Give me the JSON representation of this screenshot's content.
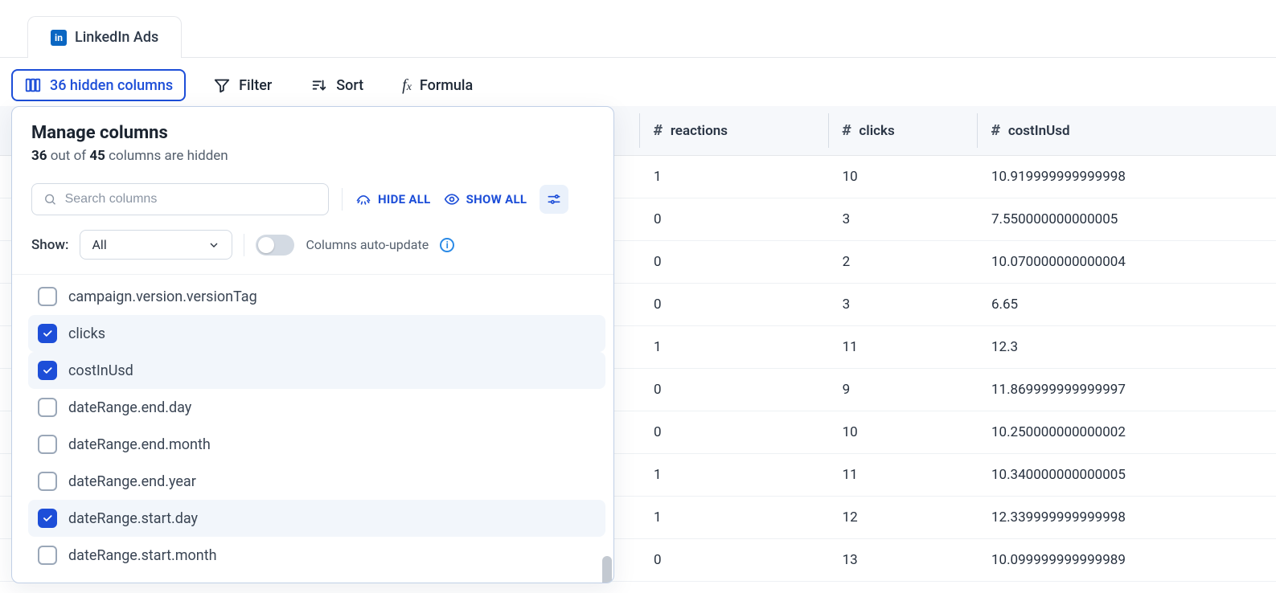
{
  "tab": {
    "label": "LinkedIn Ads",
    "icon_letters": "in"
  },
  "toolbar": {
    "hidden_columns": "36 hidden columns",
    "filter": "Filter",
    "sort": "Sort",
    "formula": "Formula"
  },
  "popover": {
    "title": "Manage columns",
    "subtitle_prefix_bold": "36",
    "subtitle_mid": " out of ",
    "subtitle_mid_bold": "45",
    "subtitle_suffix": " columns are hidden",
    "search_placeholder": "Search columns",
    "hide_all": "HIDE ALL",
    "show_all": "SHOW ALL",
    "show_label": "Show:",
    "show_value": "All",
    "auto_update": "Columns auto-update",
    "items": [
      {
        "label": "campaign.version.versionTag",
        "checked": false
      },
      {
        "label": "clicks",
        "checked": true
      },
      {
        "label": "costInUsd",
        "checked": true
      },
      {
        "label": "dateRange.end.day",
        "checked": false
      },
      {
        "label": "dateRange.end.month",
        "checked": false
      },
      {
        "label": "dateRange.end.year",
        "checked": false
      },
      {
        "label": "dateRange.start.day",
        "checked": true
      },
      {
        "label": "dateRange.start.month",
        "checked": false
      }
    ]
  },
  "table": {
    "columns": [
      {
        "key": "reactions",
        "label": "reactions"
      },
      {
        "key": "clicks",
        "label": "clicks"
      },
      {
        "key": "costInUsd",
        "label": "costInUsd"
      }
    ],
    "rows": [
      {
        "reactions": "1",
        "clicks": "10",
        "costInUsd": "10.919999999999998"
      },
      {
        "reactions": "0",
        "clicks": "3",
        "costInUsd": "7.550000000000005"
      },
      {
        "reactions": "0",
        "clicks": "2",
        "costInUsd": "10.070000000000004"
      },
      {
        "reactions": "0",
        "clicks": "3",
        "costInUsd": "6.65"
      },
      {
        "reactions": "1",
        "clicks": "11",
        "costInUsd": "12.3"
      },
      {
        "reactions": "0",
        "clicks": "9",
        "costInUsd": "11.869999999999997"
      },
      {
        "reactions": "0",
        "clicks": "10",
        "costInUsd": "10.250000000000002"
      },
      {
        "reactions": "1",
        "clicks": "11",
        "costInUsd": "10.340000000000005"
      },
      {
        "reactions": "1",
        "clicks": "12",
        "costInUsd": "12.339999999999998"
      },
      {
        "reactions": "0",
        "clicks": "13",
        "costInUsd": "10.099999999999989"
      }
    ]
  }
}
